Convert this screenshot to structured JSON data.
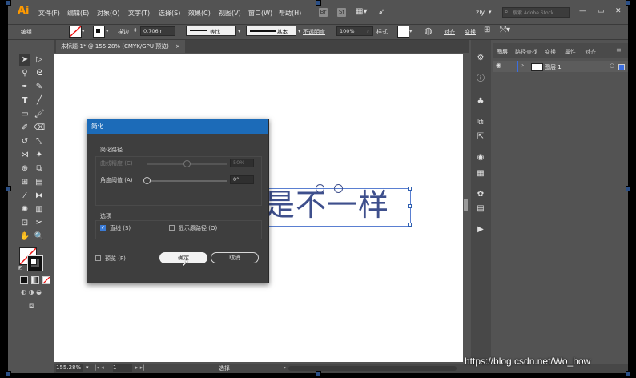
{
  "app": {
    "logo": "Ai",
    "menus": [
      "文件(F)",
      "编辑(E)",
      "对象(O)",
      "文字(T)",
      "选择(S)",
      "效果(C)",
      "视图(V)",
      "窗口(W)",
      "帮助(H)"
    ],
    "menubar_icons": [
      "bridge-icon",
      "stock-icon",
      "workspace-grid-icon",
      "rocket-icon"
    ],
    "bridge_glyph": "Br",
    "stock_glyph": "St",
    "user": "zly",
    "search_placeholder": "搜索 Adobe Stock"
  },
  "control_bar": {
    "selection_label": "编组",
    "stroke_label": "描边",
    "stroke_value": "0.706 r",
    "uniform_label": "等比",
    "basic_label": "基本",
    "opacity_label": "不透明度",
    "opacity_value": "100%",
    "style_label": "样式",
    "align_label": "对齐",
    "transform_label": "变换"
  },
  "document": {
    "tab_title": "未标题-1* @ 155.28% (CMYK/GPU 预览)",
    "close_glyph": "×",
    "canvas_text": "是不一样"
  },
  "layers_panel": {
    "tabs": [
      "图层",
      "路径查找",
      "变换",
      "属性",
      "对齐"
    ],
    "layer_name": "图层 1"
  },
  "status_bar": {
    "zoom": "155.28%",
    "page": "1",
    "mode": "选择"
  },
  "dialog": {
    "title": "简化",
    "section_path": "简化路径",
    "curve_precision_label": "曲线精度 (C)",
    "curve_precision_value": "50%",
    "curve_precision_fraction": 0.5,
    "angle_threshold_label": "角度阈值 (A)",
    "angle_threshold_value": "0°",
    "angle_threshold_fraction": 0.0,
    "section_options": "选项",
    "straight_lines_label": "直线 (S)",
    "straight_lines_checked": true,
    "show_original_label": "显示原路径 (O)",
    "show_original_checked": false,
    "preview_label": "预览 (P)",
    "preview_checked": false,
    "ok_label": "确定",
    "cancel_label": "取消"
  },
  "watermark": "https://blog.csdn.net/Wo_how",
  "colors": {
    "accent": "#1c6bb8",
    "app_bg": "#535353",
    "artboard": "#ffffff",
    "canvas_text": "#3e4f8c",
    "logo": "#ff9a00"
  }
}
